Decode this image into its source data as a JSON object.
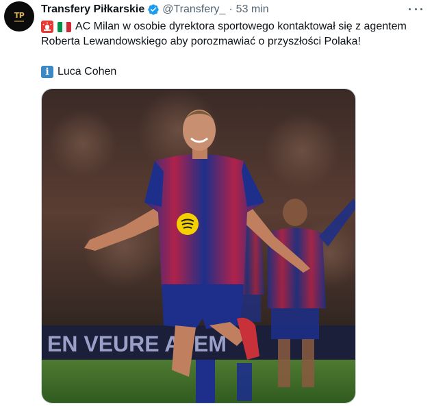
{
  "tweet": {
    "author": {
      "display_name": "Transfery Piłkarskie",
      "handle": "@Transfery_",
      "avatar_icon": "tp-logo",
      "avatar_text": "TP",
      "verified": true,
      "verified_color": "#1d9bf0"
    },
    "separator": "·",
    "timestamp": "53 min",
    "more_icon": "more-horizontal-icon",
    "text": {
      "line1": "AC Milan w osobie dyrektora sportowego kontaktował się z agentem",
      "line2": "Roberta Lewandowskiego aby porozmawiać o przyszłości Polaka!",
      "line3": "Luca Cohen"
    },
    "emojis": [
      "rotating-light-icon",
      "italy-flag-icon",
      "information-icon"
    ],
    "media": {
      "type": "photo",
      "icon": "photo-player-celebrating",
      "background_banner_text": "EN VEURE AFEM"
    }
  }
}
